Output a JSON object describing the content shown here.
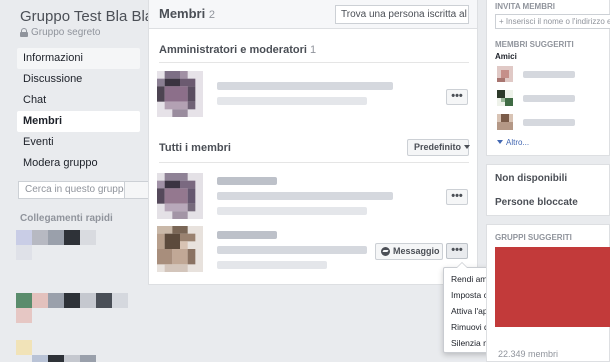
{
  "left": {
    "group_name": "Gruppo Test Bla Bla",
    "privacy": "Gruppo segreto",
    "nav": [
      {
        "label": "Informazioni"
      },
      {
        "label": "Discussione"
      },
      {
        "label": "Chat"
      },
      {
        "label": "Membri"
      },
      {
        "label": "Eventi"
      },
      {
        "label": "Modera gruppo"
      }
    ],
    "search_placeholder": "Cerca in questo gruppo",
    "quick_links_title": "Collegamenti rapidi"
  },
  "members": {
    "title": "Membri",
    "count": "2",
    "search_placeholder": "Trova una persona iscritta al",
    "admins_title": "Amministratori e moderatori",
    "admins_count": "1",
    "all_title": "Tutti i membri",
    "sort_label": "Predefinito",
    "more_label": "•••",
    "message_label": "Messaggio"
  },
  "menu": {
    "items": [
      "Rendi amministratore",
      "Imposta come moderatore",
      "Attiva l'approvazione dei post per l'autore",
      "Rimuovi dal gruppo",
      "Silenzia membro"
    ]
  },
  "right": {
    "invite_title": "INVITA MEMBRI",
    "invite_placeholder": "+ Inserisci il nome o l'indirizzo e-mail",
    "suggested_title": "MEMBRI SUGGERITI",
    "friends_label": "Amici",
    "more_label": "Altro...",
    "unavailable_label": "Non disponibili",
    "blocked_label": "Persone bloccate",
    "suggested_groups_title": "GRUPPI SUGGERITI",
    "group_members": "22.349 membri"
  }
}
